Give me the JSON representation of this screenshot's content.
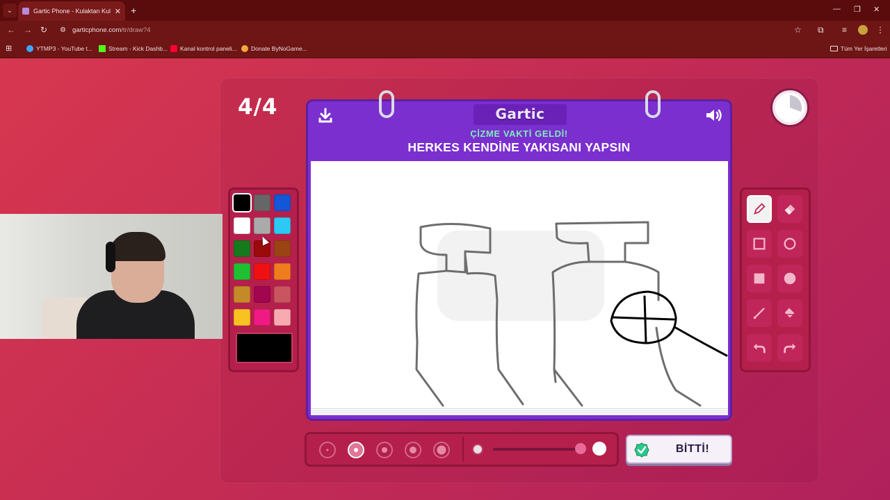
{
  "browser": {
    "tab_title": "Gartic Phone - Kulaktan Kulağa",
    "url_host": "garticphone.com",
    "url_path": "/tr/draw?4",
    "bookmarks": [
      {
        "label": "YTMP3 - YouTube t...",
        "color": "#3ea6ff"
      },
      {
        "label": "Stream - Kick Dashb...",
        "color": "#53fc18"
      },
      {
        "label": "Kanal kontrol paneli...",
        "color": "#ff0033"
      },
      {
        "label": "Donate ByNoGame...",
        "color": "#f2a93b"
      }
    ],
    "all_bookmarks": "Tüm Yer İşaretleri"
  },
  "game": {
    "round": "4/4",
    "logo": "Gartic",
    "subtitle": "ÇİZME VAKTİ GELDİ!",
    "title": "HERKES KENDİNE YAKISANI YAPSIN",
    "done_label": "BİTTİ!",
    "selected_tool": "pencil",
    "selected_brush_size": 2,
    "palette": [
      "#000000",
      "#666666",
      "#1356d6",
      "#ffffff",
      "#aaaaaa",
      "#2cc9f4",
      "#157a1c",
      "#9a0b0b",
      "#9a4414",
      "#1fbf31",
      "#ef1111",
      "#f07d1d",
      "#c48a27",
      "#a1064f",
      "#c9565e",
      "#f8c221",
      "#f01a84",
      "#f8aab0"
    ],
    "current_color": "#000000",
    "colors": {
      "notebook": "#7d2fd1",
      "panel": "#b51f4c",
      "subtitle": "#7cf0b8"
    }
  }
}
